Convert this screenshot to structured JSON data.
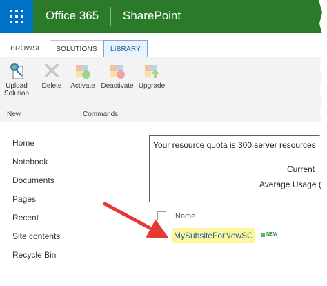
{
  "suite": {
    "brand": "Office 365",
    "app": "SharePoint"
  },
  "ribbon": {
    "tabs": [
      {
        "label": "BROWSE"
      },
      {
        "label": "SOLUTIONS"
      },
      {
        "label": "LIBRARY"
      }
    ],
    "buttons": {
      "upload": "Upload\nSolution",
      "delete": "Delete",
      "activate": "Activate",
      "deactivate": "Deactivate",
      "upgrade": "Upgrade"
    },
    "groups": {
      "new": "New",
      "commands": "Commands"
    }
  },
  "nav": {
    "items": [
      "Home",
      "Notebook",
      "Documents",
      "Pages",
      "Recent",
      "Site contents",
      "Recycle Bin"
    ]
  },
  "quota": {
    "line1": "Your resource quota is 300 server resources",
    "current": "Current",
    "average": "Average Usage ("
  },
  "list": {
    "column_name": "Name",
    "row_name": "MySubsiteForNewSC",
    "new_badge": "NEW"
  },
  "colors": {
    "suite_blue": "#0072c6",
    "suite_green": "#2a7a2a",
    "highlight": "#fbf79a",
    "arrow_red": "#e53935"
  }
}
